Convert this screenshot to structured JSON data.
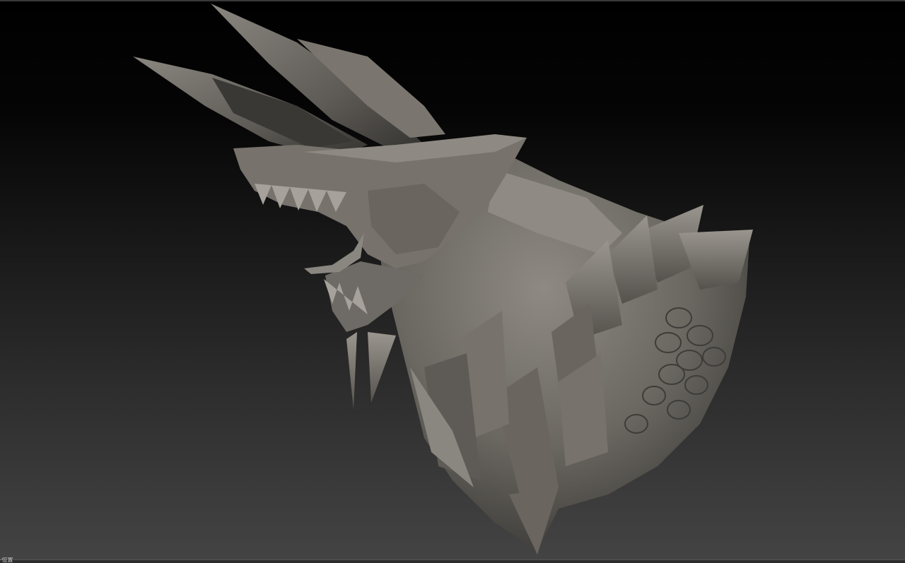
{
  "viewport": {
    "background_top": "#000000",
    "background_bottom": "#444444",
    "model_color": "#6e6b66",
    "model_highlight": "#9a968f",
    "model_shadow": "#2f2d2a"
  },
  "scene": {
    "subject": "sculpted-dragon-head-bust"
  },
  "statusbar": {
    "label": "·位置"
  }
}
